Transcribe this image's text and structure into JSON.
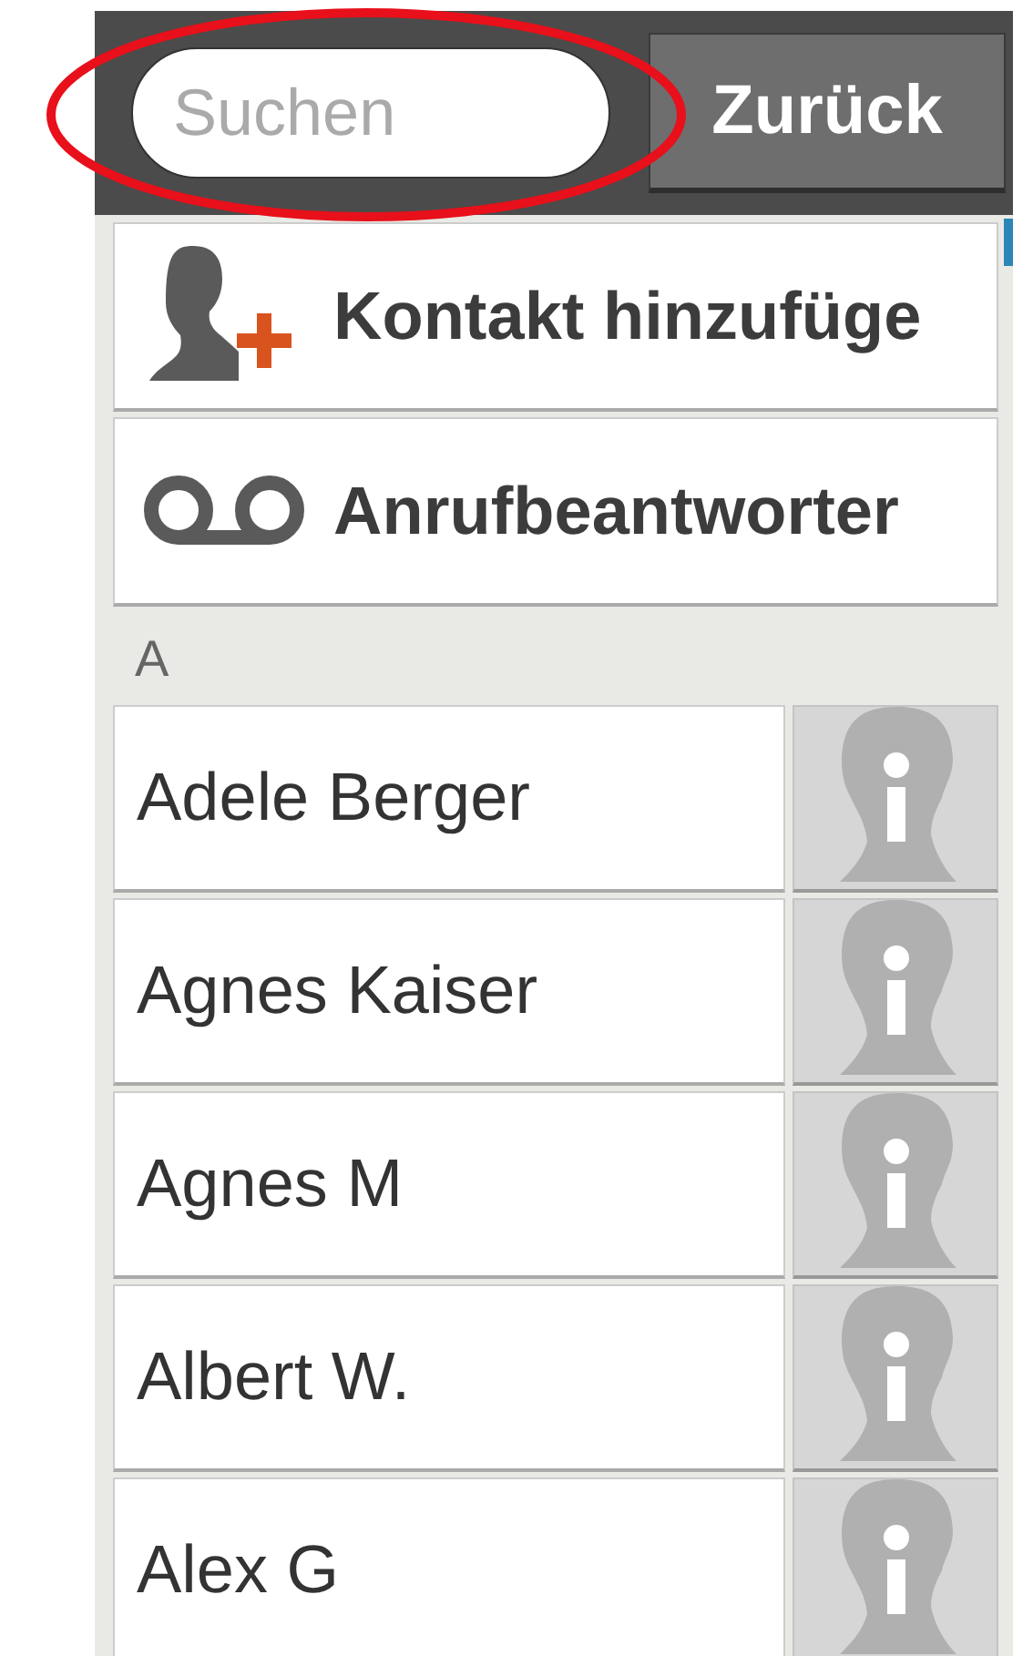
{
  "search": {
    "placeholder": "Suchen"
  },
  "back_button": {
    "label": "Zurück"
  },
  "actions": [
    {
      "kind": "add-contact",
      "label": "Kontakt hinzufüge"
    },
    {
      "kind": "voicemail",
      "label": "Anrufbeantworter"
    }
  ],
  "sections": [
    {
      "letter": "A",
      "contacts": [
        {
          "name": "Adele Berger"
        },
        {
          "name": "Agnes Kaiser"
        },
        {
          "name": "Agnes M"
        },
        {
          "name": "Albert W."
        },
        {
          "name": "Alex G"
        }
      ]
    }
  ]
}
